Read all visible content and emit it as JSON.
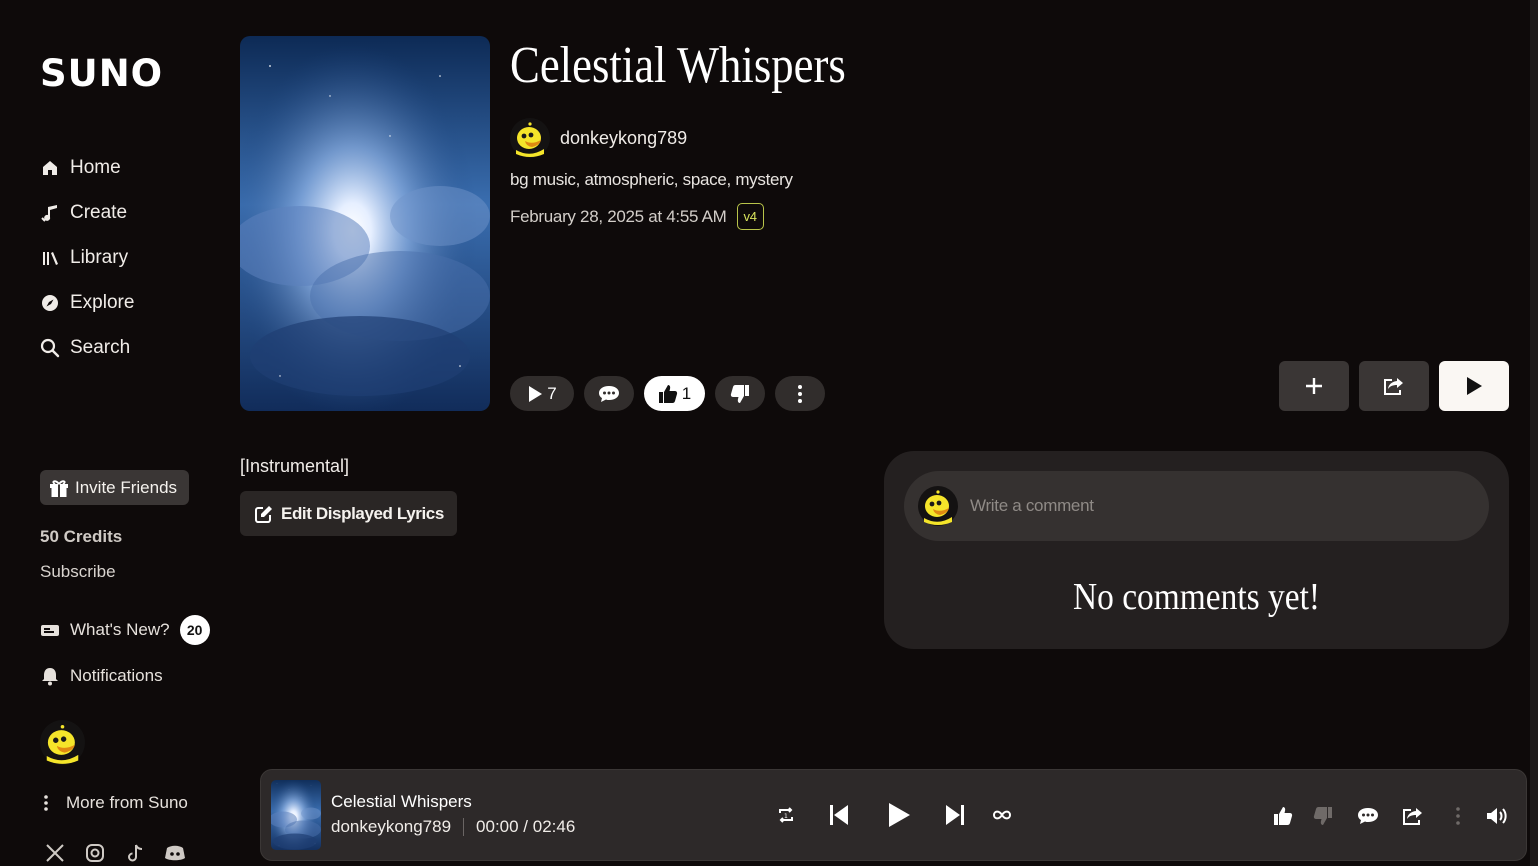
{
  "app": {
    "logo": "SUNO"
  },
  "sidebar": {
    "nav": [
      {
        "label": "Home",
        "icon": "home-icon"
      },
      {
        "label": "Create",
        "icon": "music-note-icon"
      },
      {
        "label": "Library",
        "icon": "library-icon"
      },
      {
        "label": "Explore",
        "icon": "compass-icon"
      },
      {
        "label": "Search",
        "icon": "search-icon"
      }
    ],
    "invite_label": "Invite Friends",
    "credits": "50 Credits",
    "subscribe": "Subscribe",
    "whats_new": "What's New?",
    "whats_new_count": "20",
    "notifications": "Notifications",
    "more_from_suno": "More from Suno",
    "socials": [
      "x-icon",
      "instagram-icon",
      "tiktok-icon",
      "discord-icon"
    ]
  },
  "song": {
    "title": "Celestial Whispers",
    "artist": "donkeykong789",
    "tags": "bg music, atmospheric, space, mystery",
    "date": "February 28, 2025 at 4:55 AM",
    "version": "v4",
    "play_count": "7",
    "like_count": "1",
    "lyrics": "[Instrumental]",
    "edit_lyrics_label": "Edit Displayed Lyrics"
  },
  "comments": {
    "placeholder": "Write a comment",
    "empty_text": "No comments yet!"
  },
  "player": {
    "title": "Celestial Whispers",
    "artist": "donkeykong789",
    "time": "00:00 / 02:46"
  },
  "colors": {
    "background": "#0e0a0a",
    "panel": "#242020",
    "button": "#3a3635",
    "version_badge": "#d9e45c",
    "avatar_yellow": "#f5e52a"
  }
}
